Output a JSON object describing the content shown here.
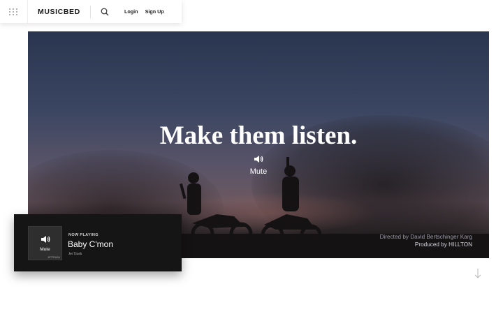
{
  "nav": {
    "logo": "MUSICBED",
    "login_label": "Login",
    "signup_label": "Sign Up",
    "menu_icon": "grid-menu-icon",
    "search_icon": "search-icon"
  },
  "hero": {
    "title": "Make them listen.",
    "mute_label": "Mute",
    "mute_icon": "speaker-icon",
    "credits": {
      "director": "Directed by David Bertschinger Karg",
      "producer": "Produced by HILLTON"
    }
  },
  "player": {
    "now_playing_label": "NOW PLAYING",
    "song_title": "Baby C'mon",
    "artist": "Jet Trash",
    "art_mute_label": "Mute",
    "art_caption": "JETTRASH"
  },
  "scroll": {
    "icon": "arrow-down-icon"
  },
  "colors": {
    "player_bg": "#151515",
    "hero_sky": "#3b4662",
    "text_white": "#ffffff"
  }
}
